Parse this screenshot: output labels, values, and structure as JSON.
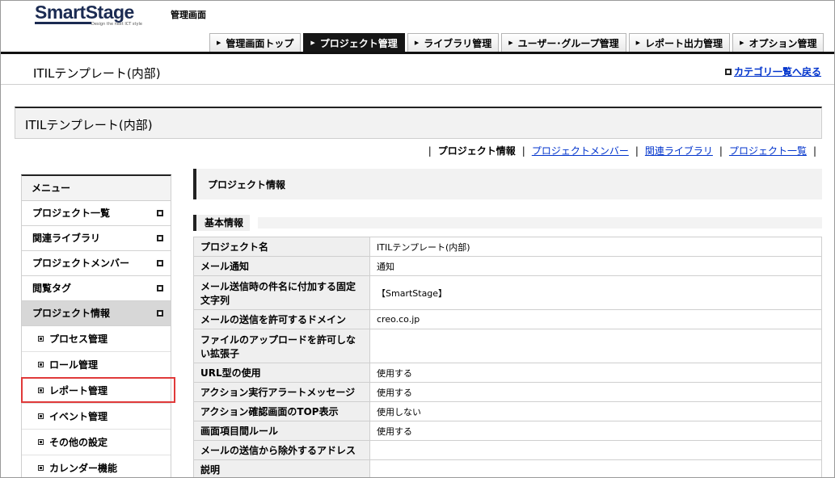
{
  "header": {
    "logo_text": "SmartStage",
    "logo_tagline": "Design the next ICT style",
    "admin_title": "管理画面",
    "tabs": [
      {
        "label": "管理画面トップ"
      },
      {
        "label": "プロジェクト管理"
      },
      {
        "label": "ライブラリ管理"
      },
      {
        "label": "ユーザー･グループ管理"
      },
      {
        "label": "レポート出力管理"
      },
      {
        "label": "オプション管理"
      }
    ],
    "active_tab": "プロジェクト管理"
  },
  "page": {
    "title": "ITILテンプレート(内部)",
    "back_link": "カテゴリ一覧へ戻る"
  },
  "project_box": {
    "title": "ITILテンプレート(内部)"
  },
  "subnav": {
    "current": "プロジェクト情報",
    "links": [
      "プロジェクトメンバー",
      "関連ライブラリ",
      "プロジェクト一覧"
    ]
  },
  "sidebar": {
    "heading": "メニュー",
    "items": [
      {
        "label": "プロジェクト一覧"
      },
      {
        "label": "関連ライブラリ"
      },
      {
        "label": "プロジェクトメンバー"
      },
      {
        "label": "閲覧タグ"
      },
      {
        "label": "プロジェクト情報"
      }
    ],
    "sub_items": [
      {
        "label": "プロセス管理"
      },
      {
        "label": "ロール管理"
      },
      {
        "label": "レポート管理"
      },
      {
        "label": "イベント管理"
      },
      {
        "label": "その他の設定"
      },
      {
        "label": "カレンダー機能"
      }
    ]
  },
  "main": {
    "section_title": "プロジェクト情報",
    "subsection_title": "基本情報",
    "rows": [
      {
        "label": "プロジェクト名",
        "value": "ITILテンプレート(内部)"
      },
      {
        "label": "メール通知",
        "value": "通知"
      },
      {
        "label": "メール送信時の件名に付加する固定文字列",
        "value": "【SmartStage】"
      },
      {
        "label": "メールの送信を許可するドメイン",
        "value": "creo.co.jp"
      },
      {
        "label": "ファイルのアップロードを許可しない拡張子",
        "value": ""
      },
      {
        "label": "URL型の使用",
        "value": "使用する"
      },
      {
        "label": "アクション実行アラートメッセージ",
        "value": "使用する"
      },
      {
        "label": "アクション確認画面のTOP表示",
        "value": "使用しない"
      },
      {
        "label": "画面項目間ルール",
        "value": "使用する"
      },
      {
        "label": "メールの送信から除外するアドレス",
        "value": ""
      },
      {
        "label": "説明",
        "value": ""
      }
    ]
  }
}
